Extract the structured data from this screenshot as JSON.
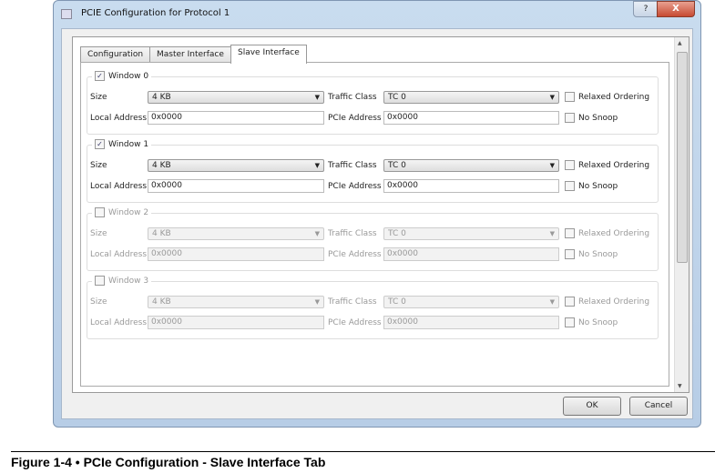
{
  "window": {
    "title": "PCIE Configuration for Protocol 1",
    "help": "?",
    "close": "X"
  },
  "tabs": [
    {
      "label": "Configuration"
    },
    {
      "label": "Master Interface"
    },
    {
      "label": "Slave Interface"
    }
  ],
  "labels": {
    "size": "Size",
    "traffic": "Traffic Class",
    "local": "Local Address",
    "pcie": "PCIe Address",
    "relaxed": "Relaxed Ordering",
    "snoop": "No Snoop"
  },
  "windows": [
    {
      "name": "Window 0",
      "enabled": true,
      "size": "4 KB",
      "tc": "TC 0",
      "local": "0x0000",
      "pcie": "0x0000"
    },
    {
      "name": "Window 1",
      "enabled": true,
      "size": "4 KB",
      "tc": "TC 0",
      "local": "0x0000",
      "pcie": "0x0000"
    },
    {
      "name": "Window 2",
      "enabled": false,
      "size": "4 KB",
      "tc": "TC 0",
      "local": "0x0000",
      "pcie": "0x0000"
    },
    {
      "name": "Window 3",
      "enabled": false,
      "size": "4 KB",
      "tc": "TC 0",
      "local": "0x0000",
      "pcie": "0x0000"
    }
  ],
  "buttons": {
    "ok": "OK",
    "cancel": "Cancel"
  },
  "caption": "Figure 1-4 • PCIe Configuration - Slave Interface Tab"
}
